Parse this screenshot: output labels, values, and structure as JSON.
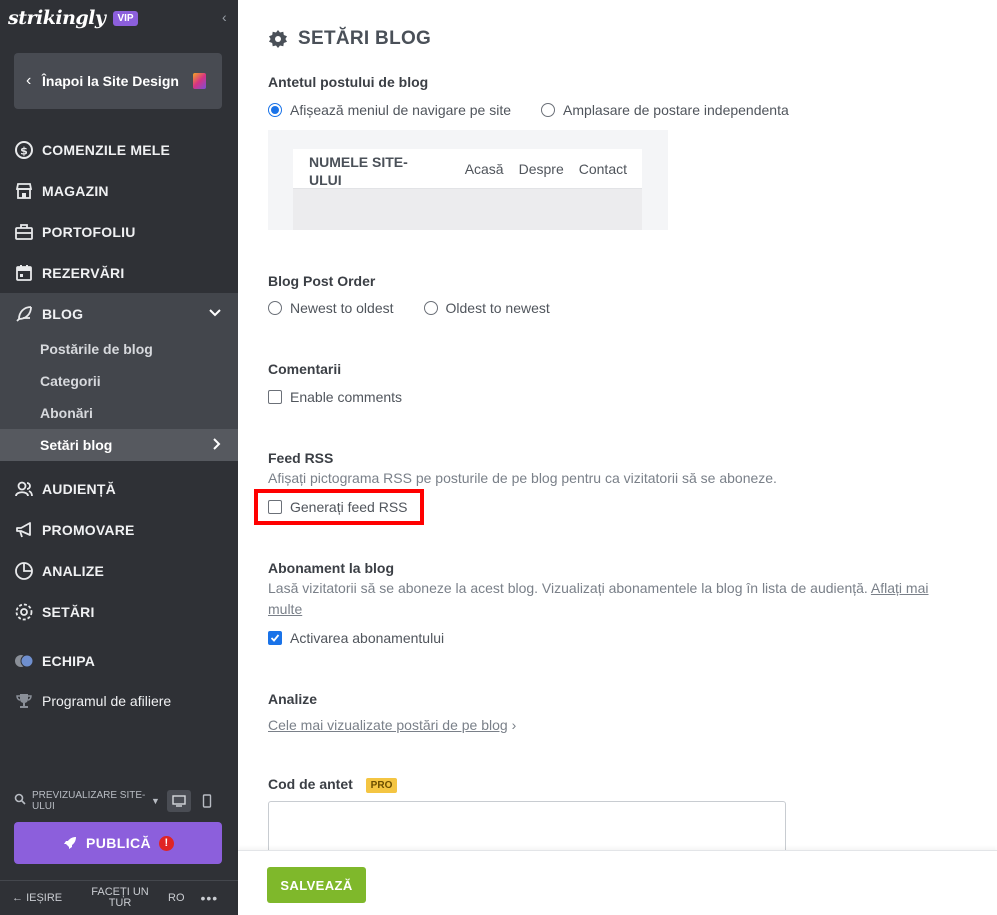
{
  "sidebar": {
    "logo": "strikingly",
    "vip_badge": "VIP",
    "back_label": "Înapoi la Site Design",
    "nav": {
      "orders": "COMENZILE MELE",
      "store": "MAGAZIN",
      "portfolio": "PORTOFOLIU",
      "bookings": "REZERVĂRI",
      "blog": "BLOG",
      "audience": "AUDIENȚĂ",
      "promotion": "PROMOVARE",
      "analytics": "ANALIZE",
      "settings": "SETĂRI",
      "team": "ECHIPA",
      "affiliate": "Programul de afiliere"
    },
    "blog_sub": {
      "posts": "Postările de blog",
      "categories": "Categorii",
      "subscriptions": "Abonări",
      "blog_settings": "Setări blog"
    },
    "preview_label": "PREVIZUALIZARE SITE-ULUI",
    "publish_label": "PUBLICĂ",
    "publish_alert": "!",
    "exit_label": "IEȘIRE",
    "tour_label": "FACEȚI UN TUR",
    "lang": "RO",
    "more": "•••"
  },
  "main": {
    "title": "SETĂRI BLOG",
    "post_header": {
      "heading": "Antetul postului de blog",
      "option_1": "Afișează meniul de navigare pe site",
      "option_2": "Amplasare de postare independenta",
      "selected": 1,
      "preview": {
        "site_name": "NUMELE SITE-ULUI",
        "links": [
          "Acasă",
          "Despre",
          "Contact"
        ]
      }
    },
    "post_order": {
      "heading": "Blog Post Order",
      "option_1": "Newest to oldest",
      "option_2": "Oldest to newest"
    },
    "comments": {
      "heading": "Comentarii",
      "checkbox": "Enable comments",
      "checked": false
    },
    "rss": {
      "heading": "Feed RSS",
      "description": "Afișați pictograma RSS pe posturile de pe blog pentru ca vizitatorii să se aboneze.",
      "checkbox": "Generați feed RSS",
      "checked": false
    },
    "subscription": {
      "heading": "Abonament la blog",
      "description": "Lasă vizitatorii să se aboneze la acest blog. Vizualizați abonamentele la blog în lista de audiență.",
      "link": "Aflați mai multe",
      "checkbox": "Activarea abonamentului",
      "checked": true
    },
    "analytics": {
      "heading": "Analize",
      "link": "Cele mai vizualizate postări de pe blog",
      "chevron": "›"
    },
    "header_code": {
      "heading": "Cod de antet",
      "badge": "PRO"
    },
    "save_label": "SALVEAZĂ"
  },
  "colors": {
    "sidebar_bg": "#2f3136",
    "accent_purple": "#8c5fdc",
    "save_green": "#7fb82b",
    "checkbox_blue": "#1a73e8",
    "highlight_red": "#ff0000"
  }
}
